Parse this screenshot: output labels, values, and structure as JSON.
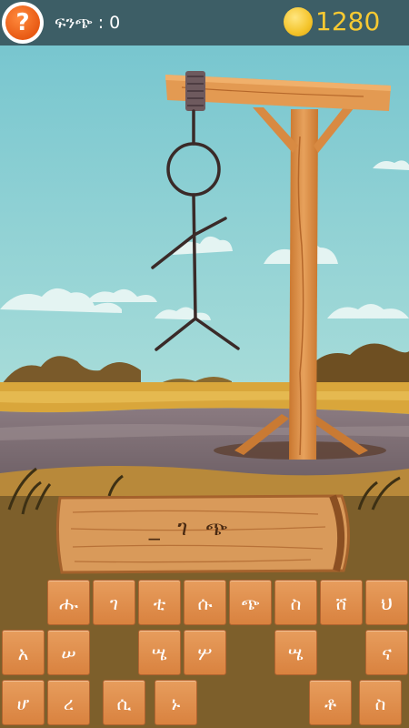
{
  "header": {
    "help_icon_text": "?",
    "score_label": "ፍንጭ : 0",
    "coins": "1280"
  },
  "game": {
    "word_display": "_ ገ ጭ"
  },
  "keyboard": {
    "row1": [
      "ሑ",
      "ገ",
      "ቲ",
      "ሱ",
      "ጭ",
      "ስ",
      "ሸ",
      "ህ"
    ],
    "row2": [
      "አ",
      "ሠ",
      "",
      "ሤ",
      "ሦ",
      "",
      "ሤ",
      "",
      "ና"
    ],
    "row3": [
      "ሆ",
      "ረ",
      "ሲ",
      "ኑ",
      "",
      "",
      "ቶ",
      "ስ"
    ]
  },
  "colors": {
    "topbar": "#3d5e66",
    "coin_text": "#f7c932",
    "key": "#e08c48"
  }
}
